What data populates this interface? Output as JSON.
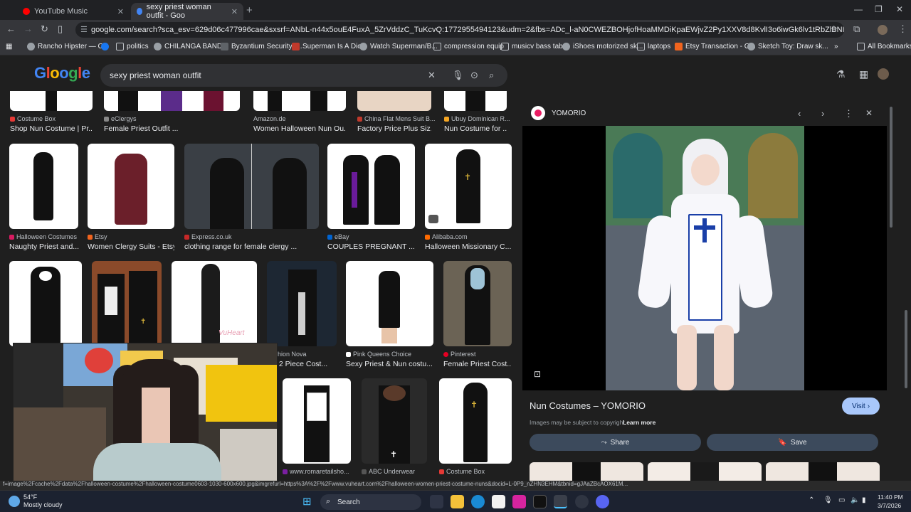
{
  "browser": {
    "tabs": [
      {
        "title": "YouTube Music",
        "color": "#ff0000"
      },
      {
        "title": "sexy priest woman outfit - Goo",
        "color": "#4285f4"
      }
    ],
    "url": "google.com/search?sca_esv=629d06c477996cae&sxsrf=ANbL-n44x5ouE4FuxA_5ZrVddzC_TuKcvQ:1772955494123&udm=2&fbs=ADc_l-aN0CWEZBOHjofHoaMMDiKpaEWjvZ2Py1XXV8d8KvlI3o6iwGk6lv1tRbZlBNIVs-5-bUj3iBI-UxHsANYwOkWWuvsX..."
  },
  "bookmarks": [
    "Rancho Hipster — C...",
    "politics",
    "CHILANGA BANDA",
    "Byzantium Security I...",
    "Superman Is A Dick",
    "Watch Superman/B...",
    "compression equip",
    "musicv bass tabs",
    "iShoes motorized sk...",
    "laptops",
    "Etsy Transaction - G...",
    "Sketch Toy: Draw sk...",
    "All Bookmarks"
  ],
  "google": {
    "logo": "Google",
    "query": "sexy priest woman outfit"
  },
  "results_row0": [
    {
      "source": "Costume Box",
      "title": "Shop Nun Costume | Pr..."
    },
    {
      "source": "eClergys",
      "title": "Female Priest Outfit ..."
    },
    {
      "source": "Amazon.de",
      "title": "Women Halloween Nun Ou..."
    },
    {
      "source": "China Flat Mens Suit B...",
      "title": "Factory Price Plus Siz..."
    },
    {
      "source": "Ubuy Dominican R...",
      "title": "Nun Costume for ..."
    }
  ],
  "results_row1": [
    {
      "source": "Halloween Costumes",
      "title": "Naughty Priest and..."
    },
    {
      "source": "Etsy",
      "title": "Women Clergy Suits - Etsy"
    },
    {
      "source": "Express.co.uk",
      "title": "clothing range for female clergy ..."
    },
    {
      "source": "eBay",
      "title": "COUPLES PREGNANT ..."
    },
    {
      "source": "Alibaba.com",
      "title": "Halloween Missionary C..."
    }
  ],
  "results_row2": [
    {
      "source": "Fashion Nova",
      "title": "est 2 Piece Cost..."
    },
    {
      "source": "Pink Queens Choice",
      "title": "Sexy Priest & Nun costu..."
    },
    {
      "source": "Pinterest",
      "title": "Female Priest Cost..."
    }
  ],
  "results_row3": [
    {
      "source": "www.romaretailsho...",
      "title": ""
    },
    {
      "source": "ABC Underwear",
      "title": ""
    },
    {
      "source": "Costume Box",
      "title": ""
    }
  ],
  "panel": {
    "site": "YOMORIO",
    "title": "Nun Costumes – YOMORIO",
    "visit": "Visit",
    "copyright": "Images may be subject to copyright.",
    "learn_more": "Learn more",
    "share": "Share",
    "save": "Save"
  },
  "status_url": "f=image%2Fcache%2Fdata%2Fhalloween-costume%2Fhalloween-costume0603-1030-600x600.jpg&imgrefurl=https%3A%2F%2Fwww.vuheart.com%2Fhalloween-women-priest-costume-nuns&docid=L-0P9_nZHN3EHM&tbnid=gJAaZBcAOX61M...",
  "taskbar": {
    "temp": "54°F",
    "weather": "Mostly cloudy",
    "search": "Search",
    "time": "11:40 PM",
    "date": "3/7/2026"
  }
}
